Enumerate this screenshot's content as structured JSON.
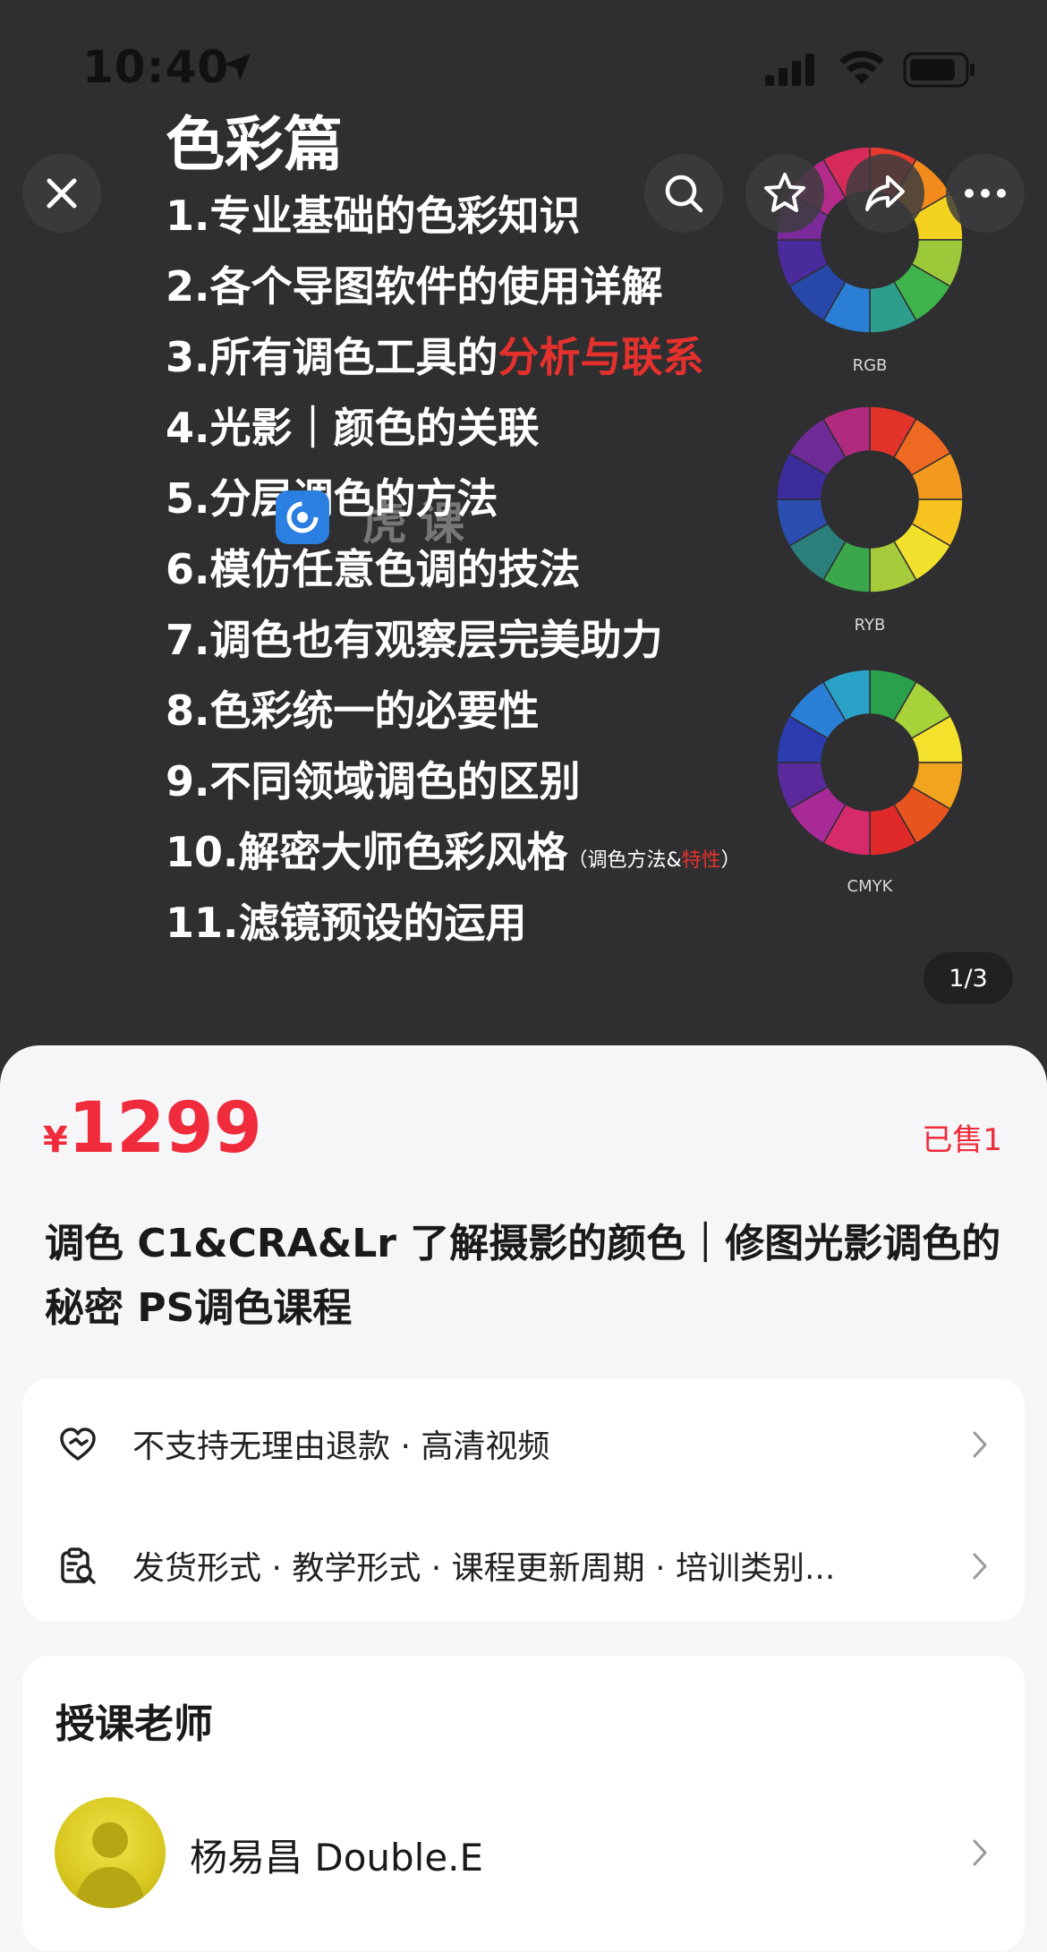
{
  "status_bar": {
    "time": "10:40"
  },
  "slide": {
    "title": "色彩篇",
    "items": [
      {
        "text": "1.专业基础的色彩知识"
      },
      {
        "text": "2.各个导图软件的使用详解"
      },
      {
        "text": "3.所有调色工具的",
        "highlight": "分析与联系"
      },
      {
        "text": "4.光影｜颜色的关联"
      },
      {
        "text": "5.分层调色的方法"
      },
      {
        "text": "6.模仿任意色调的技法"
      },
      {
        "text": "7.调色也有观察层完美助力"
      },
      {
        "text": "8.色彩统一的必要性"
      },
      {
        "text": "9.不同领域调色的区别"
      },
      {
        "text": "10.解密大师色彩风格",
        "note_prefix": "（调色方法&",
        "note_highlight": "特性",
        "note_suffix": "）"
      },
      {
        "text": "11.滤镜预设的运用"
      }
    ],
    "wheels": [
      {
        "label": "RGB"
      },
      {
        "label": "RYB"
      },
      {
        "label": "CMYK"
      }
    ],
    "watermark": "虎课",
    "pager": "1/3"
  },
  "toolbar": {
    "close": "close-icon",
    "search": "search-icon",
    "favorite": "star-icon",
    "share": "share-icon",
    "more": "more-icon"
  },
  "product": {
    "currency": "¥",
    "price": "1299",
    "sold": "已售1",
    "title": "调色 C1&CRA&Lr 了解摄影的颜色｜修图光影调色的秘密 PS调色课程"
  },
  "info": {
    "refund": "不支持无理由退款 · 高清视频",
    "details": "发货形式 · 教学形式 · 课程更新周期 · 培训类别..."
  },
  "teacher": {
    "section_title": "授课老师",
    "name": "杨易昌 Double.E"
  },
  "colors": {
    "price_red": "#f02b3c",
    "slide_bg": "#2f2f31",
    "sheet_bg": "#f6f6f8"
  }
}
